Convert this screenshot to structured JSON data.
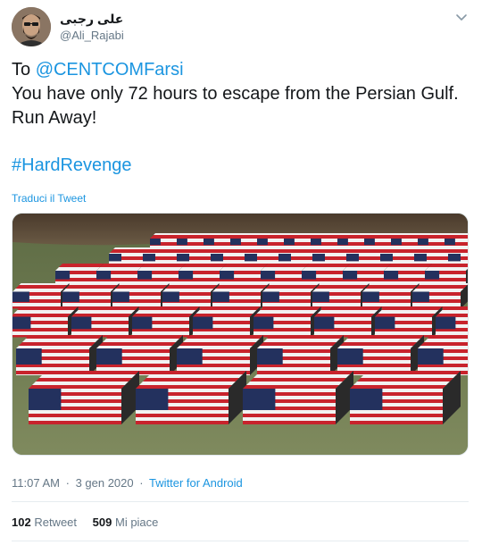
{
  "author": {
    "display_name": "علی رجبی",
    "handle": "@Ali_Rajabi"
  },
  "tweet": {
    "to_prefix": "To ",
    "mention": "@CENTCOMFarsi",
    "line2": "You have only 72 hours to escape from the Persian Gulf.",
    "line3": "Run Away!",
    "hashtag": "#HardRevenge",
    "translate_label": "Traduci il Tweet"
  },
  "meta": {
    "time": "11:07 AM",
    "separator": "·",
    "date": "3 gen 2020",
    "source": "Twitter for Android"
  },
  "stats": {
    "retweets_count": "102",
    "retweets_label": "Retweet",
    "likes_count": "509",
    "likes_label": "Mi piace"
  },
  "icons": {
    "menu": "chevron-down-icon"
  },
  "colors": {
    "link": "#1b95e0",
    "secondary_text": "#657786",
    "primary_text": "#14171a"
  }
}
